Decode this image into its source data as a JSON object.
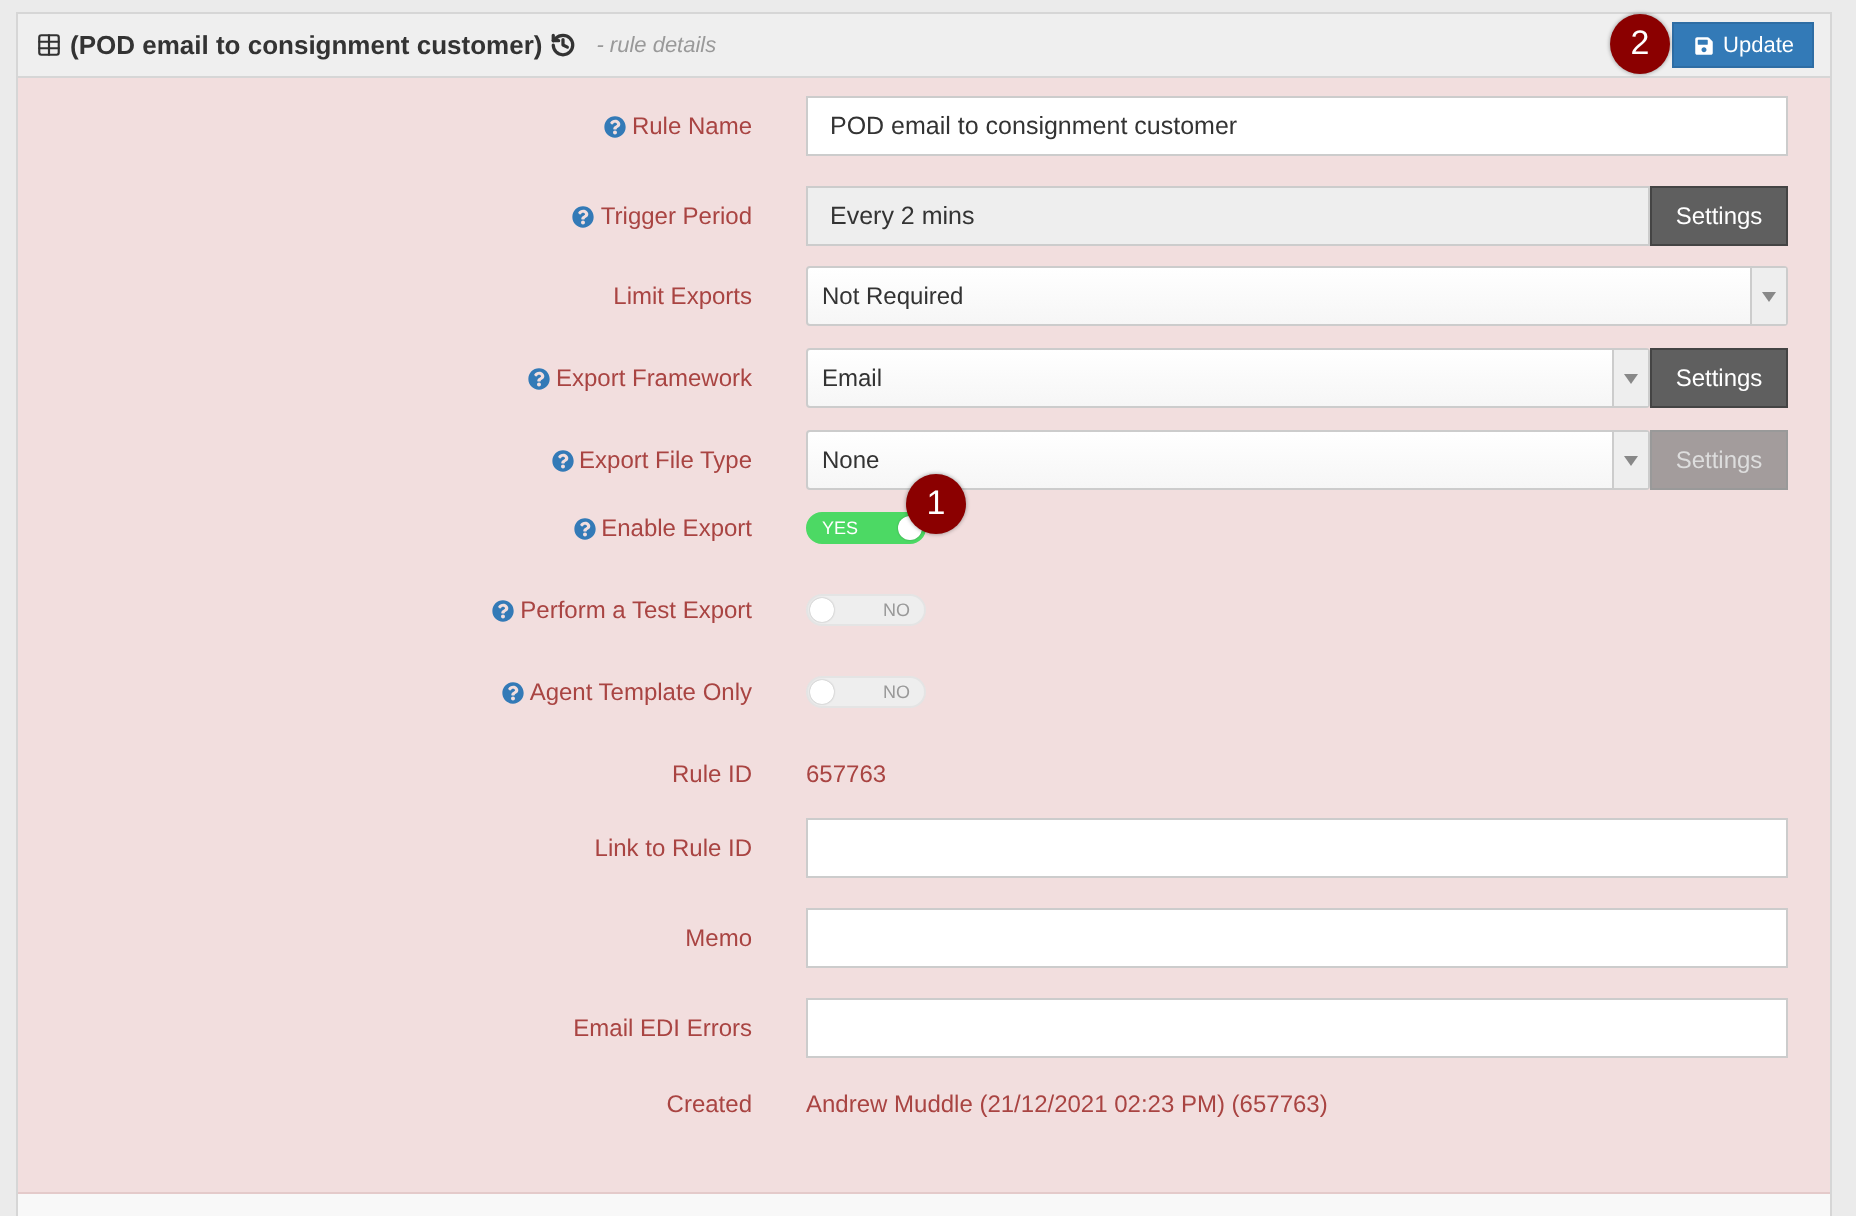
{
  "header": {
    "title": "(POD email to consignment customer)",
    "subtitle": "- rule details",
    "update_button": "Update",
    "badge": "2"
  },
  "rows": [
    {
      "kind": "input",
      "label": "Rule Name",
      "help": true,
      "value": "POD email to consignment customer"
    },
    {
      "kind": "setting",
      "label": "Trigger Period",
      "help": true,
      "value": "Every 2 mins",
      "button": "Settings",
      "button_disabled": false
    },
    {
      "kind": "select",
      "label": "Limit Exports",
      "help": false,
      "value": "Not Required"
    },
    {
      "kind": "select",
      "label": "Export Framework",
      "help": true,
      "value": "Email",
      "button": "Settings",
      "button_disabled": false
    },
    {
      "kind": "select",
      "label": "Export File Type",
      "help": true,
      "value": "None",
      "button": "Settings",
      "button_disabled": true
    },
    {
      "kind": "toggle",
      "label": "Enable Export",
      "help": true,
      "on": true,
      "state_text": "YES",
      "badge": "1"
    },
    {
      "kind": "toggle",
      "label": "Perform a Test Export",
      "help": true,
      "on": false,
      "state_text": "NO"
    },
    {
      "kind": "toggle",
      "label": "Agent Template Only",
      "help": true,
      "on": false,
      "state_text": "NO"
    },
    {
      "kind": "static",
      "label": "Rule ID",
      "help": false,
      "value": "657763"
    },
    {
      "kind": "input",
      "label": "Link to Rule ID",
      "help": false
    },
    {
      "kind": "input",
      "label": "Memo",
      "help": false
    },
    {
      "kind": "input",
      "label": "Email EDI Errors",
      "help": false
    },
    {
      "kind": "static",
      "label": "Created",
      "help": false,
      "value": "Andrew Muddle (21/12/2021 02:23 PM) (657763)"
    }
  ]
}
